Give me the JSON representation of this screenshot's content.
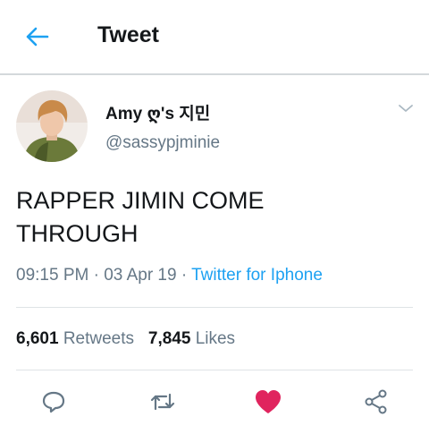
{
  "header": {
    "title": "Tweet",
    "back_icon": "arrow-left-icon"
  },
  "tweet": {
    "author_name": "Amy ღ's 지민",
    "author_handle": "@sassypjminie",
    "text_line1": "RAPPER JIMIN COME",
    "text_line2": "THROUGH",
    "time": "09:15 PM",
    "date": "03 Apr 19",
    "source": "Twitter for Iphone",
    "separator": "·"
  },
  "stats": {
    "retweets_count": "6,601",
    "retweets_label": "Retweets",
    "likes_count": "7,845",
    "likes_label": "Likes"
  },
  "actions": {
    "reply_icon": "reply-icon",
    "retweet_icon": "retweet-icon",
    "like_icon": "heart-icon",
    "share_icon": "share-icon",
    "liked": true
  },
  "colors": {
    "accent": "#1da1f2",
    "like_active": "#e0245e",
    "secondary_text": "#657786",
    "primary_text": "#14171a"
  }
}
